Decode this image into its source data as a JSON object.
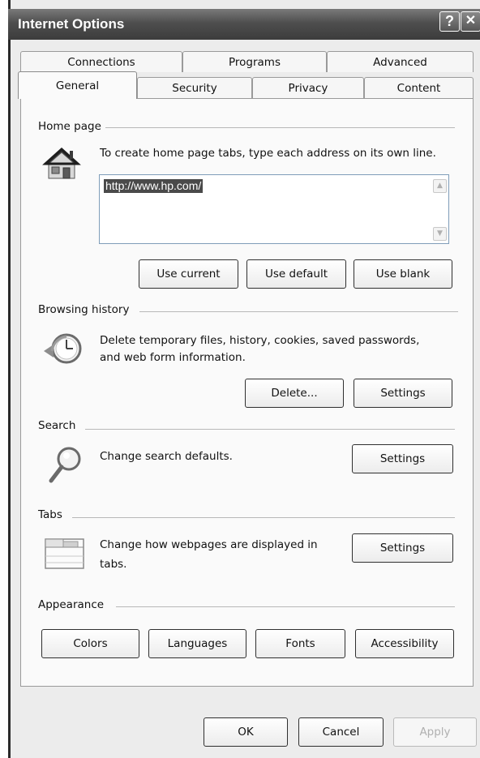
{
  "window": {
    "title": "Internet Options",
    "help_label": "?",
    "close_label": "✕"
  },
  "tabs": {
    "row1": [
      "Connections",
      "Programs",
      "Advanced"
    ],
    "row2": [
      "General",
      "Security",
      "Privacy",
      "Content"
    ],
    "active": "General"
  },
  "home_page": {
    "heading": "Home page",
    "description": "To create home page tabs, type each address on its own line.",
    "url_value": "http://www.hp.com/",
    "icon": "house-icon",
    "buttons": {
      "use_current": "Use current",
      "use_default": "Use default",
      "use_blank": "Use blank"
    }
  },
  "browsing_history": {
    "heading": "Browsing history",
    "description_line1": "Delete temporary files, history, cookies, saved passwords,",
    "description_line2": "and web form information.",
    "icon": "clock-history-icon",
    "buttons": {
      "delete": "Delete...",
      "settings": "Settings"
    }
  },
  "search": {
    "heading": "Search",
    "description": "Change search defaults.",
    "icon": "magnifier-icon",
    "buttons": {
      "settings": "Settings"
    }
  },
  "tabs_section": {
    "heading": "Tabs",
    "description_line1": "Change how webpages are displayed in",
    "description_line2": "tabs.",
    "icon": "tabs-window-icon",
    "buttons": {
      "settings": "Settings"
    }
  },
  "appearance": {
    "heading": "Appearance",
    "buttons": {
      "colors": "Colors",
      "languages": "Languages",
      "fonts": "Fonts",
      "accessibility": "Accessibility"
    }
  },
  "footer": {
    "ok": "OK",
    "cancel": "Cancel",
    "apply": "Apply"
  }
}
